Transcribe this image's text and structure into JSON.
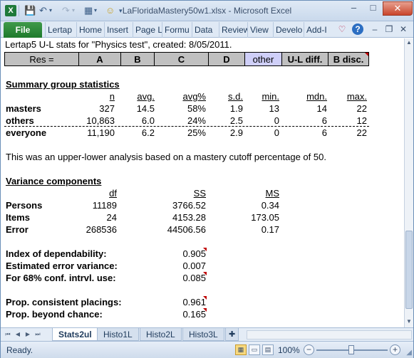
{
  "window": {
    "title": "LaFloridaMastery50w1.xlsx - Microsoft Excel",
    "minimize": "–",
    "maximize": "□",
    "close": "✕"
  },
  "quick_access": {
    "icons": [
      "excel-logo",
      "save-icon",
      "undo-icon",
      "redo-icon",
      "table-icon",
      "smiley-icon",
      "customize-icon"
    ]
  },
  "ribbon": {
    "file": "File",
    "tabs": [
      "Lertap",
      "Home",
      "Insert",
      "Page L",
      "Formu",
      "Data",
      "Review",
      "View",
      "Develo",
      "Add-I"
    ],
    "right_icons": [
      "heart-icon",
      "help-icon",
      "minimize-ribbon-icon",
      "restore-icon",
      "close-icon"
    ]
  },
  "sheet": {
    "title_line": "Lertap5 U-L stats for \"Physics test\", created: 8/05/2011.",
    "header": {
      "res": "Res =",
      "a": "A",
      "b": "B",
      "c": "C",
      "d": "D",
      "other": "other",
      "ul_diff": "U-L diff.",
      "b_disc": "B disc."
    },
    "summary": {
      "heading": "Summary group statistics",
      "cols": [
        "n",
        "avg.",
        "avg%",
        "s.d.",
        "min.",
        "mdn.",
        "max."
      ],
      "rows": [
        {
          "label": "masters",
          "n": "327",
          "avg": "14.5",
          "avgp": "58%",
          "sd": "1.9",
          "min": "13",
          "mdn": "14",
          "max": "22"
        },
        {
          "label": "others",
          "n": "10,863",
          "avg": "6.0",
          "avgp": "24%",
          "sd": "2.5",
          "min": "0",
          "mdn": "6",
          "max": "12"
        },
        {
          "label": "everyone",
          "n": "11,190",
          "avg": "6.2",
          "avgp": "25%",
          "sd": "2.9",
          "min": "0",
          "mdn": "6",
          "max": "22"
        }
      ]
    },
    "analysis_note": "This was an upper-lower analysis based on a mastery cutoff percentage of 50.",
    "variance": {
      "heading": "Variance components",
      "cols": [
        "df",
        "SS",
        "MS"
      ],
      "rows": [
        {
          "label": "Persons",
          "df": "11189",
          "ss": "3766.52",
          "ms": "0.34"
        },
        {
          "label": "Items",
          "df": "24",
          "ss": "4153.28",
          "ms": "173.05"
        },
        {
          "label": "Error",
          "df": "268536",
          "ss": "44506.56",
          "ms": "0.17"
        }
      ]
    },
    "indices": [
      {
        "label": "Index of dependability:",
        "value": "0.905"
      },
      {
        "label": "Estimated error variance:",
        "value": "0.007"
      },
      {
        "label": "For 68% conf. intrvl. use:",
        "value": "0.085"
      }
    ],
    "placings": [
      {
        "label": "Prop. consistent placings:",
        "value": "0.961"
      },
      {
        "label": "Prop. beyond chance:",
        "value": "0.165"
      }
    ]
  },
  "sheet_tabs": [
    "Stats2ul",
    "Histo1L",
    "Histo2L",
    "Histo3L"
  ],
  "status": {
    "ready": "Ready.",
    "zoom": "100%",
    "zoom_level_percent": 100
  }
}
